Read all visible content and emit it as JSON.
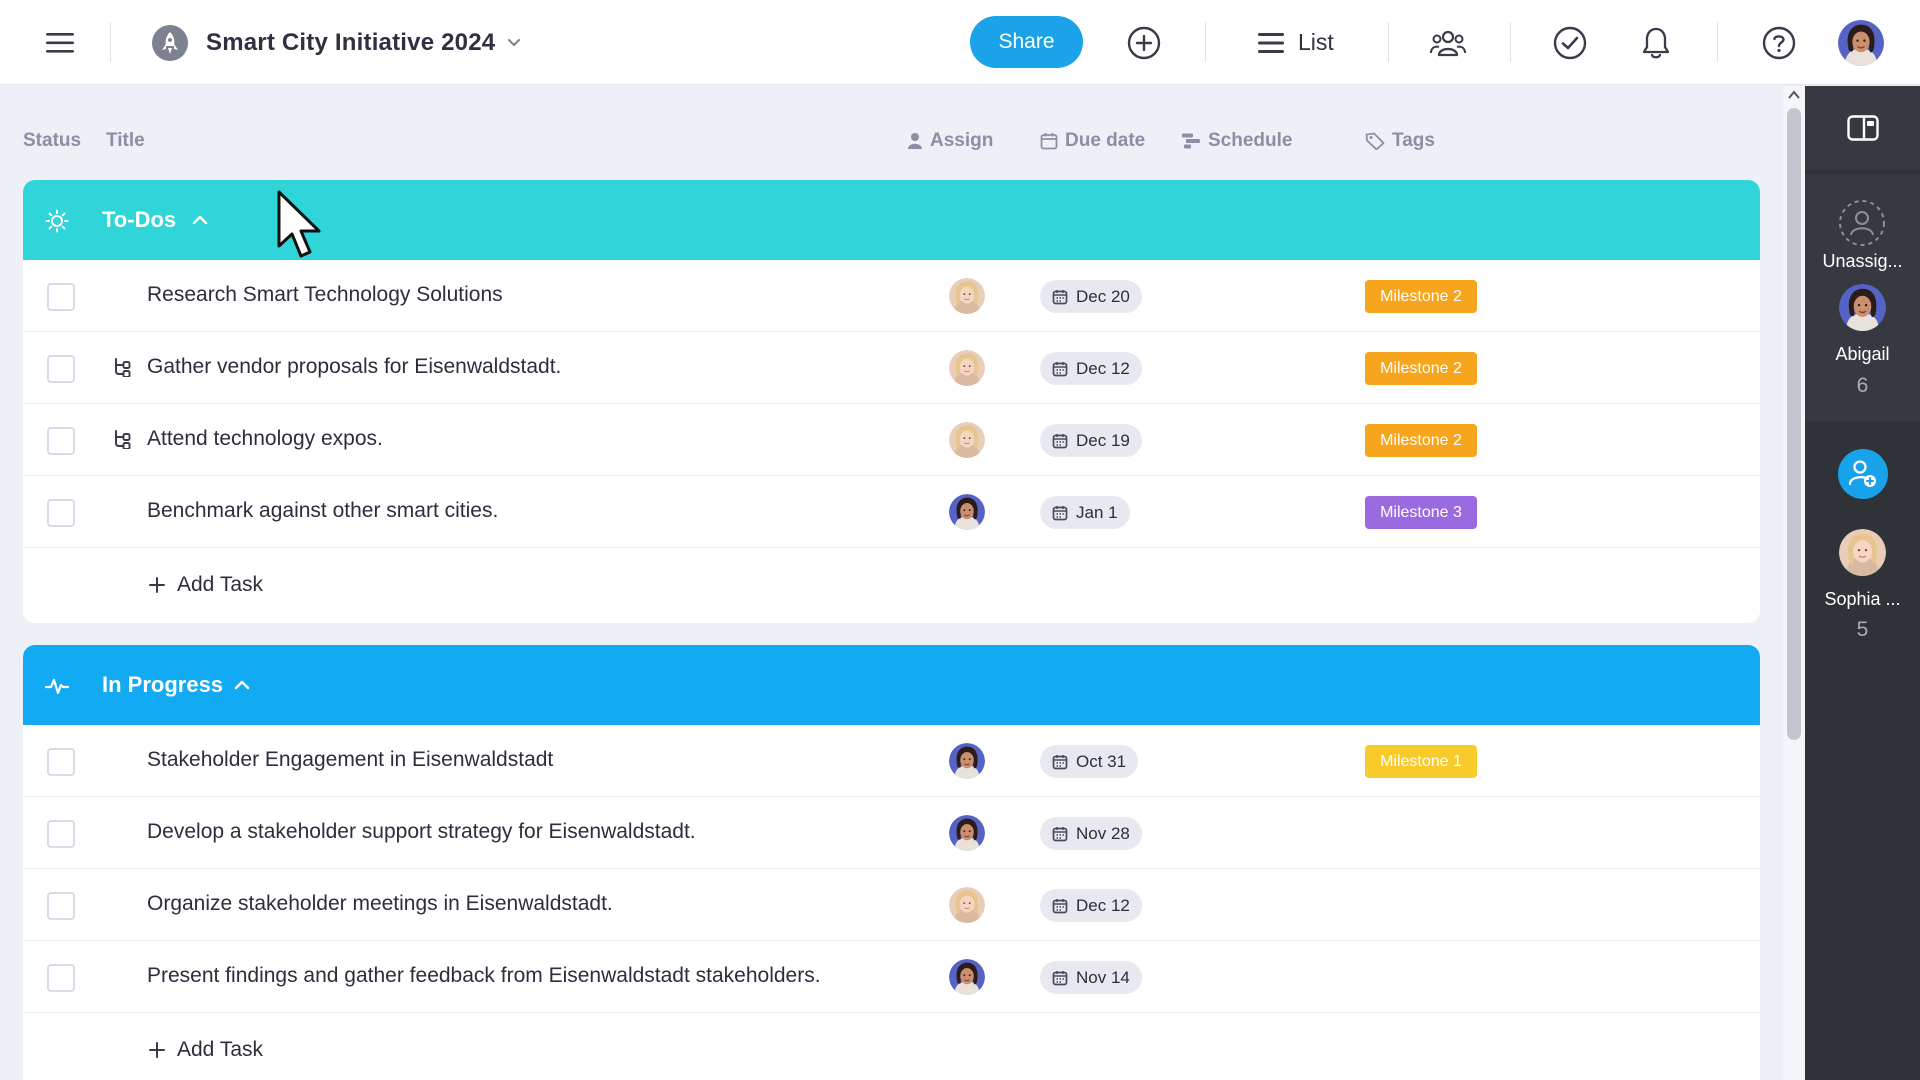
{
  "project": {
    "title": "Smart City Initiative 2024"
  },
  "toolbar": {
    "share_label": "Share",
    "view_label": "List"
  },
  "columns": {
    "status": "Status",
    "title": "Title",
    "assign": "Assign",
    "due_date": "Due date",
    "schedule": "Schedule",
    "tags": "Tags"
  },
  "colors": {
    "todos_header": "#2fd5d8",
    "inprogress_header": "#12aaf2",
    "milestone_orange": "#f7a51c",
    "milestone_purple": "#9a6ae0",
    "milestone_yellow": "#f7cc2a",
    "share_blue": "#1aa3e8"
  },
  "groups": [
    {
      "name": "To-Dos",
      "icon": "sun-icon",
      "tasks": [
        {
          "title": "Research Smart Technology Solutions",
          "subtask": false,
          "assignee": "Sophia",
          "due": "Dec 20",
          "tag": "Milestone 2",
          "tag_color": "#f7a51c"
        },
        {
          "title": "Gather vendor proposals for Eisenwaldstadt.",
          "subtask": true,
          "assignee": "Sophia",
          "due": "Dec 12",
          "tag": "Milestone 2",
          "tag_color": "#f7a51c"
        },
        {
          "title": "Attend technology expos.",
          "subtask": true,
          "assignee": "Sophia",
          "due": "Dec 19",
          "tag": "Milestone 2",
          "tag_color": "#f7a51c"
        },
        {
          "title": "Benchmark against other smart cities.",
          "subtask": false,
          "assignee": "Abigail",
          "due": "Jan 1",
          "tag": "Milestone 3",
          "tag_color": "#9a6ae0"
        }
      ],
      "add_label": "Add Task"
    },
    {
      "name": "In Progress",
      "icon": "activity-icon",
      "tasks": [
        {
          "title": "Stakeholder Engagement in Eisenwaldstadt",
          "subtask": false,
          "assignee": "Abigail",
          "due": "Oct 31",
          "tag": "Milestone 1",
          "tag_color": "#f7cc2a"
        },
        {
          "title": "Develop a stakeholder support strategy for Eisenwaldstadt.",
          "subtask": false,
          "assignee": "Abigail",
          "due": "Nov 28",
          "tag": "",
          "tag_color": ""
        },
        {
          "title": "Organize stakeholder meetings in Eisenwaldstadt.",
          "subtask": false,
          "assignee": "Sophia",
          "due": "Dec 12",
          "tag": "",
          "tag_color": ""
        },
        {
          "title": "Present findings and gather feedback from Eisenwaldstadt stakeholders.",
          "subtask": false,
          "assignee": "Abigail",
          "due": "Nov 14",
          "tag": "",
          "tag_color": ""
        }
      ],
      "add_label": "Add Task"
    }
  ],
  "right_panel": {
    "unassigned_label": "Unassig...",
    "people": [
      {
        "name": "Abigail",
        "count": "6"
      },
      {
        "name": "Sophia ...",
        "count": "5"
      }
    ]
  }
}
